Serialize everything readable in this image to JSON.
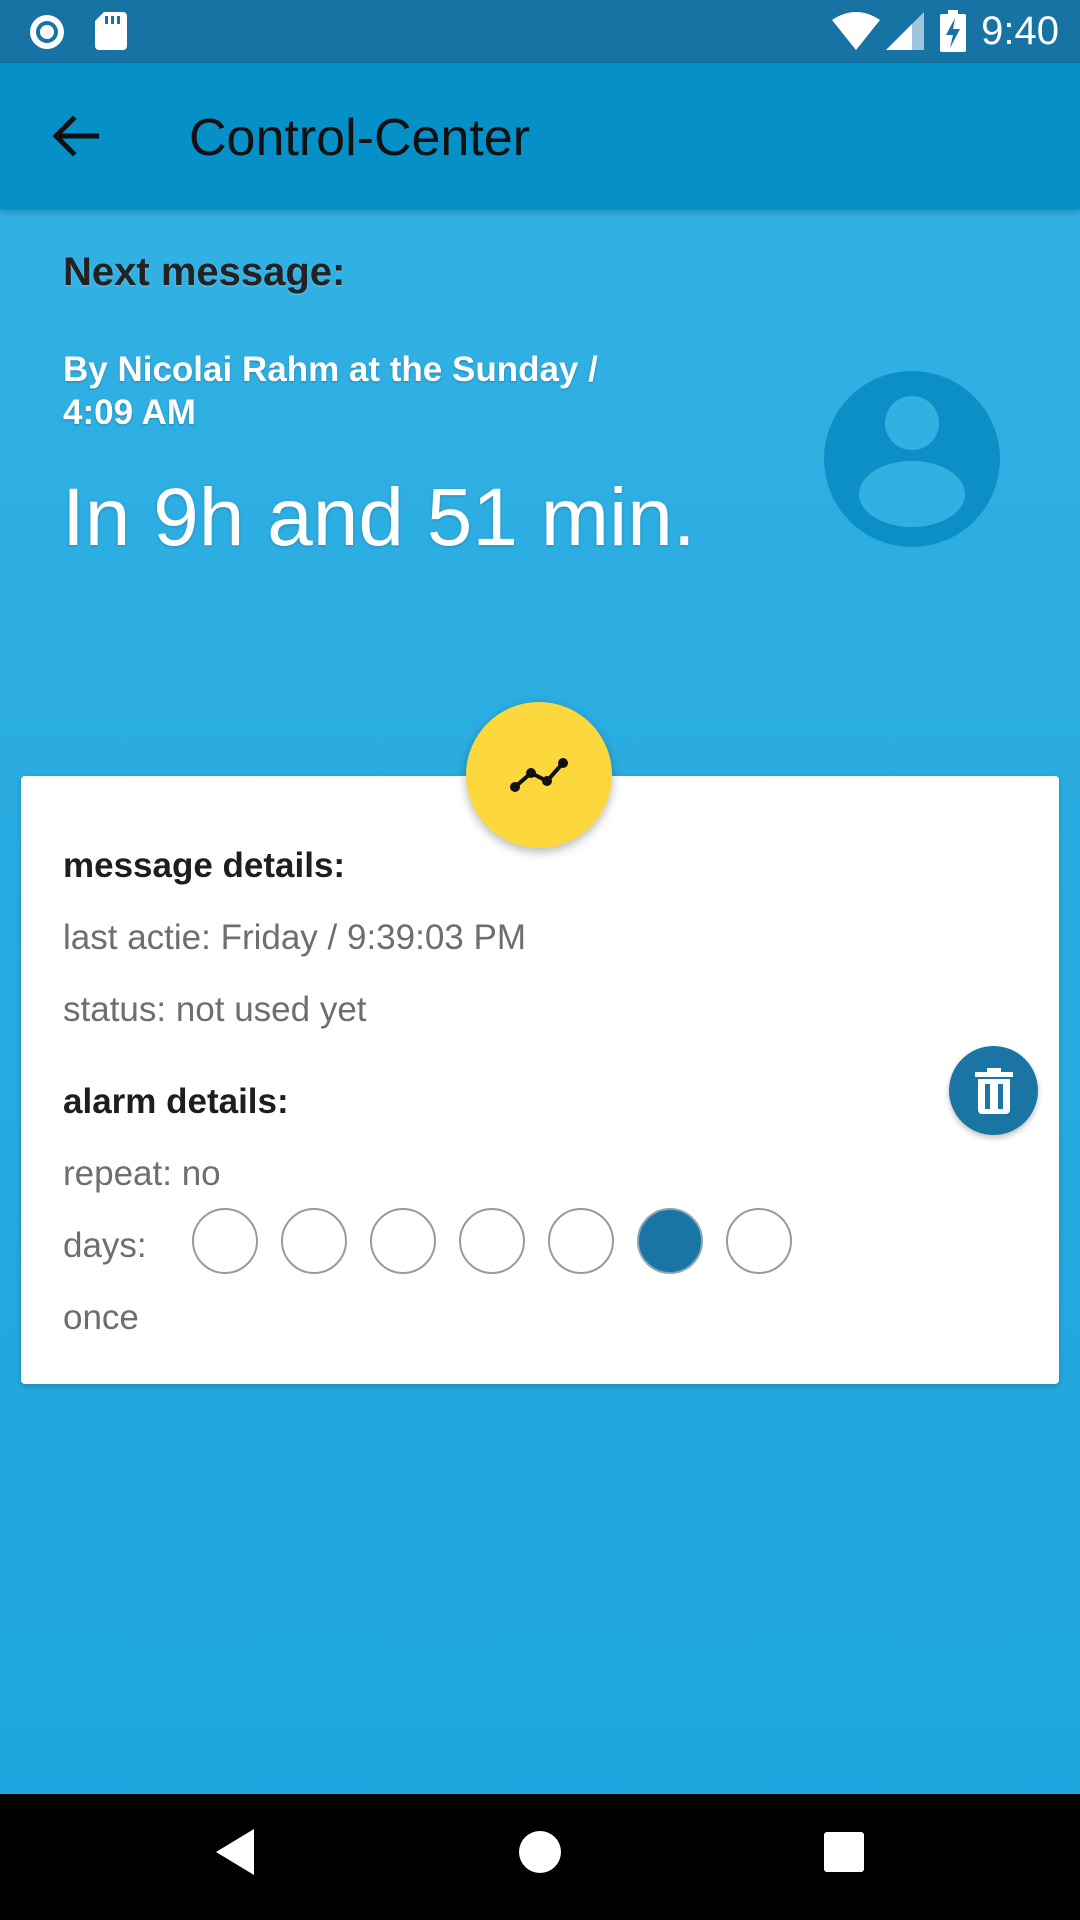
{
  "status_bar": {
    "time": "9:40",
    "icons": [
      "radio-icon",
      "sd-card-icon",
      "wifi-icon",
      "signal-icon",
      "battery-charging-icon"
    ]
  },
  "app_bar": {
    "title": "Control-Center",
    "back_icon": "arrow-back-icon"
  },
  "header": {
    "next_label": "Next message:",
    "sender_line": "By Nicolai Rahm at the Sunday / 4:09 AM",
    "countdown": "In 9h and 51 min.",
    "avatar_icon": "person-icon"
  },
  "fab": {
    "icon": "trending-chart-icon"
  },
  "card": {
    "message_heading": "message details:",
    "last_action": "last actie: Friday / 9:39:03 PM",
    "status": "status: not used yet",
    "alarm_heading": "alarm details:",
    "repeat": "repeat: no",
    "days_label": "days:",
    "days_selected": [
      false,
      false,
      false,
      false,
      false,
      true,
      false
    ],
    "frequency": "once",
    "delete_icon": "trash-icon"
  },
  "nav_bar": {
    "icons": [
      "back-triangle-icon",
      "home-circle-icon",
      "recents-square-icon"
    ]
  },
  "colors": {
    "status_bar": "#1673a4",
    "app_bar": "#0591c8",
    "background": "#1ba4dd",
    "fab": "#fdd83d",
    "accent_dark": "#1a75a5"
  }
}
